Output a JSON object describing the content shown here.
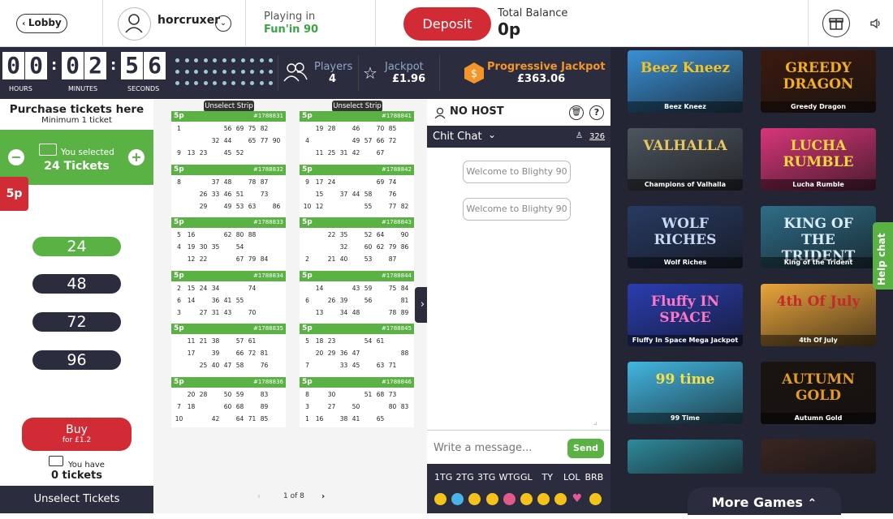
{
  "header": {
    "lobby_label": "Lobby",
    "username": "horcruxer",
    "playing_in_label": "Playing in",
    "room_name": "Fun'in 90",
    "deposit_label": "Deposit",
    "total_balance_label": "Total Balance",
    "total_balance_value": "0p",
    "icons": [
      "back-chevron-icon",
      "user-avatar-icon",
      "chevron-down-icon",
      "gift-icon",
      "speaker-icon"
    ]
  },
  "timer": {
    "hours": "00",
    "minutes": "02",
    "seconds": "56",
    "hours_label": "HOURS",
    "minutes_label": "MINUTES",
    "seconds_label": "SECONDS"
  },
  "stats": {
    "players_label": "Players",
    "players_value": "4",
    "jackpot_label": "Jackpot",
    "jackpot_value": "£1.96",
    "progressive_label": "Progressive Jackpot",
    "progressive_value": "£363.06"
  },
  "purchase": {
    "title": "Purchase tickets here",
    "subtitle": "Minimum 1 ticket",
    "you_selected_label": "You selected",
    "selected_value": "24 Tickets",
    "price_tab": "5p",
    "quick_options": [
      "24",
      "48",
      "72",
      "96"
    ],
    "buy_label": "Buy",
    "buy_price": "for £1.2",
    "you_have_label": "You have",
    "you_have_value": "0 tickets",
    "unselect_label": "Unselect Tickets",
    "colors": {
      "green": "#5ab245",
      "navy": "#2b2d3f",
      "red": "#d12c35"
    }
  },
  "strips": [
    {
      "header": "Unselect Strip",
      "tickets": [
        {
          "price": "5p",
          "id": "#1788831",
          "rows": [
            [
              "1",
              "",
              "",
              "",
              "56",
              "69",
              "75",
              "82"
            ],
            [
              "",
              "",
              "",
              "32",
              "44",
              "",
              "65",
              "77",
              "90"
            ],
            [
              "9",
              "13",
              "23",
              "",
              "45",
              "52"
            ]
          ]
        },
        {
          "price": "5p",
          "id": "#1788832",
          "rows": [
            [
              "8",
              "",
              "",
              "37",
              "48",
              "",
              "78",
              "87"
            ],
            [
              "",
              "",
              "26",
              "33",
              "46",
              "51",
              "",
              "73"
            ],
            [
              "",
              "",
              "29",
              "",
              "49",
              "53",
              "63",
              "",
              "86"
            ]
          ]
        },
        {
          "price": "5p",
          "id": "#1788833",
          "rows": [
            [
              "5",
              "16",
              "",
              "",
              "62",
              "80",
              "88"
            ],
            [
              "4",
              "19",
              "30",
              "35",
              "",
              "54"
            ],
            [
              "",
              "12",
              "22",
              "",
              "",
              "67",
              "79",
              "84"
            ]
          ]
        },
        {
          "price": "5p",
          "id": "#1788834",
          "rows": [
            [
              "2",
              "15",
              "24",
              "34",
              "",
              "",
              "74"
            ],
            [
              "6",
              "14",
              "",
              "36",
              "41",
              "55"
            ],
            [
              "3",
              "",
              "27",
              "31",
              "43",
              "",
              "70"
            ]
          ]
        },
        {
          "price": "5p",
          "id": "#1788835",
          "rows": [
            [
              "",
              "11",
              "21",
              "38",
              "",
              "57",
              "61"
            ],
            [
              "",
              "17",
              "",
              "39",
              "",
              "66",
              "72",
              "81"
            ],
            [
              "",
              "",
              "25",
              "40",
              "47",
              "58",
              "",
              "76"
            ]
          ]
        },
        {
          "price": "5p",
          "id": "#1788836",
          "rows": [
            [
              "",
              "20",
              "28",
              "",
              "50",
              "59",
              "",
              "83"
            ],
            [
              "7",
              "18",
              "",
              "",
              "60",
              "68",
              "",
              "89"
            ],
            [
              "10",
              "",
              "",
              "42",
              "",
              "64",
              "71",
              "85"
            ]
          ]
        }
      ]
    },
    {
      "header": "Unselect Strip",
      "tickets": [
        {
          "price": "5p",
          "id": "#1788841",
          "rows": [
            [
              "",
              "19",
              "28",
              "",
              "46",
              "",
              "70",
              "85"
            ],
            [
              "4",
              "",
              "",
              "",
              "49",
              "57",
              "66",
              "72"
            ],
            [
              "",
              "11",
              "25",
              "31",
              "42",
              "",
              "67"
            ]
          ]
        },
        {
          "price": "5p",
          "id": "#1788842",
          "rows": [
            [
              "9",
              "17",
              "24",
              "",
              "",
              "",
              "69",
              "74"
            ],
            [
              "",
              "15",
              "",
              "37",
              "44",
              "58",
              "",
              "76"
            ],
            [
              "10",
              "12",
              "",
              "",
              "",
              "55",
              "",
              "77",
              "82"
            ]
          ]
        },
        {
          "price": "5p",
          "id": "#1788843",
          "rows": [
            [
              "",
              "",
              "22",
              "35",
              "",
              "52",
              "64",
              "",
              "90"
            ],
            [
              "",
              "",
              "",
              "32",
              "",
              "60",
              "62",
              "79",
              "86"
            ],
            [
              "2",
              "",
              "21",
              "40",
              "",
              "53",
              "",
              "87"
            ]
          ]
        },
        {
          "price": "5p",
          "id": "#1788844",
          "rows": [
            [
              "",
              "14",
              "",
              "",
              "43",
              "59",
              "",
              "75",
              "84"
            ],
            [
              "6",
              "",
              "26",
              "39",
              "",
              "56",
              "",
              "",
              "81"
            ],
            [
              "",
              "13",
              "",
              "34",
              "48",
              "",
              "",
              "78",
              "89"
            ]
          ]
        },
        {
          "price": "5p",
          "id": "#1788845",
          "rows": [
            [
              "5",
              "18",
              "23",
              "",
              "",
              "54",
              "61"
            ],
            [
              "",
              "20",
              "29",
              "36",
              "47",
              "",
              "",
              "",
              "88"
            ],
            [
              "7",
              "",
              "",
              "33",
              "45",
              "",
              "63",
              "71"
            ]
          ]
        },
        {
          "price": "5p",
          "id": "#1788846",
          "rows": [
            [
              "8",
              "",
              "30",
              "",
              "",
              "51",
              "68",
              "73"
            ],
            [
              "3",
              "",
              "27",
              "",
              "50",
              "",
              "",
              "80",
              "83"
            ],
            [
              "1",
              "16",
              "",
              "38",
              "41",
              "",
              "65"
            ]
          ]
        }
      ]
    }
  ],
  "pager": {
    "text": "1 of 8",
    "prev": "‹",
    "next": "›"
  },
  "chat": {
    "no_host_label": "NO HOST",
    "room_label": "Chit Chat",
    "user_count": "326",
    "messages": [
      "Welcome to Blighty 90",
      "Welcome to Blighty 90"
    ],
    "input_placeholder": "Write a message...",
    "send_label": "Send",
    "abbreviations": [
      "1TG",
      "2TG",
      "3TG",
      "WTG",
      "GL",
      "TY",
      "LOL",
      "BRB"
    ],
    "emoji_names": [
      "smile-icon",
      "cool-icon",
      "grin-icon",
      "happy-icon",
      "mask-icon",
      "angel-icon",
      "sad-icon",
      "worried-icon",
      "heart-icon",
      "surprised-icon"
    ]
  },
  "games": [
    {
      "name": "Beez Kneez",
      "art": "Beez Kneez",
      "bg": "#3a8fd4",
      "fg": "#f7c21d"
    },
    {
      "name": "Greedy Dragon",
      "art": "GREEDY DRAGON",
      "bg": "#3b1a10",
      "fg": "#f0b020"
    },
    {
      "name": "Champions of Valhalla",
      "art": "VALHALLA",
      "bg": "#4d5560",
      "fg": "#e9c65c"
    },
    {
      "name": "Lucha Rumble",
      "art": "LUCHA RUMBLE",
      "bg": "#d8367a",
      "fg": "#f8d73b"
    },
    {
      "name": "Wolf Riches",
      "art": "WOLF RICHES",
      "bg": "#283a62",
      "fg": "#c7d8f4"
    },
    {
      "name": "King of the Trident",
      "art": "KING OF THE TRIDENT",
      "bg": "#2f6d88",
      "fg": "#d9ecf5"
    },
    {
      "name": "Fluffy In Space Mega Jackpot",
      "art": "Fluffy IN SPACE",
      "bg": "#2a3db1",
      "fg": "#ff76c4"
    },
    {
      "name": "4th Of July",
      "art": "4th Of July",
      "bg": "#e8a53c",
      "fg": "#c42a2a"
    },
    {
      "name": "99 Time",
      "art": "99 time",
      "bg": "#43b6e0",
      "fg": "#f7e044"
    },
    {
      "name": "Autumn Gold",
      "art": "AUTUMN GOLD",
      "bg": "#1b1410",
      "fg": "#e49a24"
    },
    {
      "name": "",
      "art": "",
      "bg": "#2f8a9c",
      "fg": "#ffffff"
    },
    {
      "name": "",
      "art": "",
      "bg": "#3a2622",
      "fg": "#ffffff"
    }
  ],
  "help_chat_label": "Help chat",
  "more_games_label": "More Games"
}
